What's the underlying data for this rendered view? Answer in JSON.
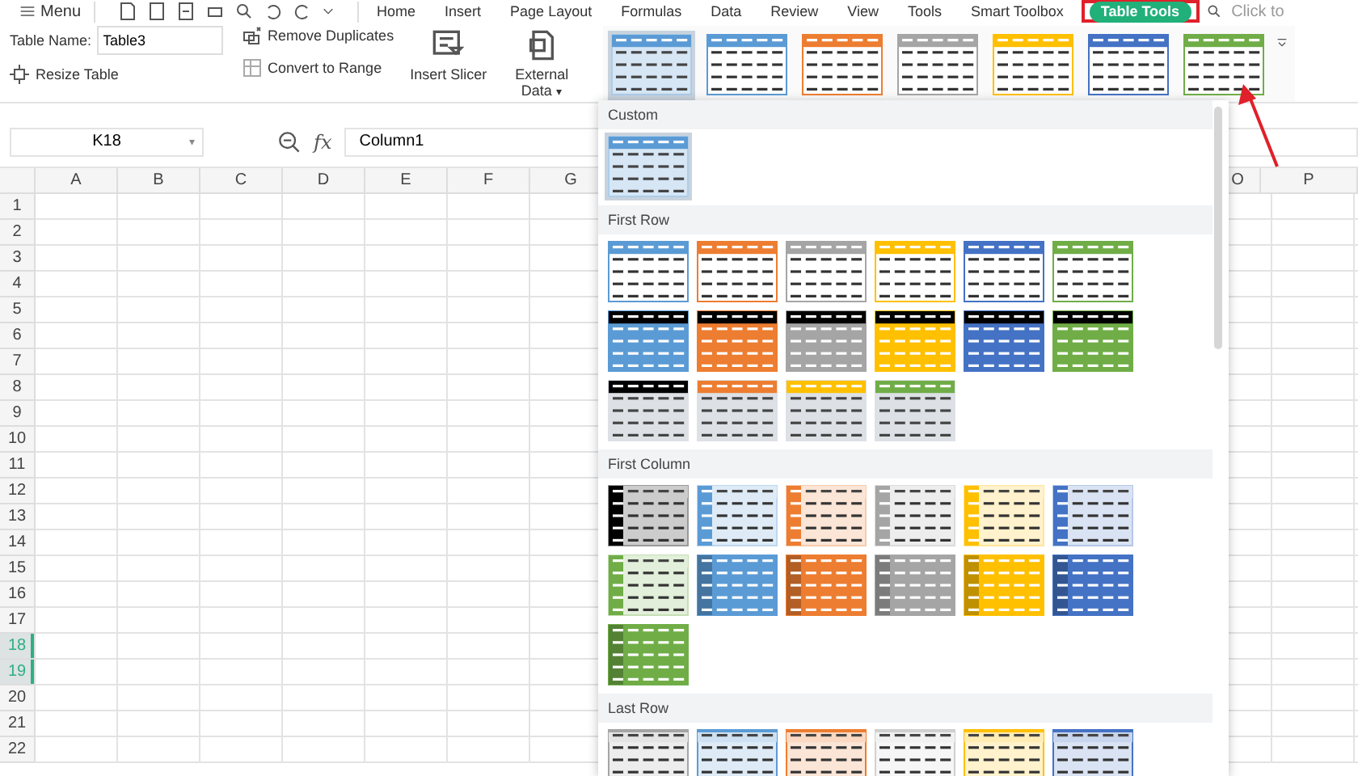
{
  "menu_bar": {
    "menu_label": "Menu",
    "tabs": [
      {
        "label": "Home",
        "selected": false
      },
      {
        "label": "Insert",
        "selected": false
      },
      {
        "label": "Page Layout",
        "selected": false
      },
      {
        "label": "Formulas",
        "selected": false
      },
      {
        "label": "Data",
        "selected": false
      },
      {
        "label": "Review",
        "selected": false
      },
      {
        "label": "View",
        "selected": false
      },
      {
        "label": "Tools",
        "selected": false
      },
      {
        "label": "Smart Toolbox",
        "selected": false
      },
      {
        "label": "Table Tools",
        "selected": true
      }
    ],
    "search": {
      "placeholder": "Click to"
    }
  },
  "ribbon": {
    "table_name_label": "Table Name:",
    "table_name_value": "Table3",
    "resize_table": "Resize Table",
    "remove_duplicates": "Remove Duplicates",
    "convert_to_range": "Convert to Range",
    "insert_slicer": "Insert Slicer",
    "external_data": "External Data",
    "external_data_caret": "▾",
    "styles": [
      {
        "kind": "custom",
        "color": "#5b9bd5",
        "selected": true
      },
      {
        "kind": "outline",
        "color": "#5b9bd5",
        "selected": false
      },
      {
        "kind": "outline",
        "color": "#ed7d31",
        "selected": false
      },
      {
        "kind": "outline",
        "color": "#a5a5a5",
        "selected": false
      },
      {
        "kind": "outline",
        "color": "#ffc000",
        "selected": false
      },
      {
        "kind": "outline",
        "color": "#4472c4",
        "selected": false
      },
      {
        "kind": "outline",
        "color": "#70ad47",
        "selected": false
      }
    ]
  },
  "formula_bar": {
    "name_box": "K18",
    "name_box_caret": "▾",
    "function_label": "fx",
    "formula": "Column1"
  },
  "sheet": {
    "columns": [
      "A",
      "B",
      "C",
      "D",
      "E",
      "F",
      "G",
      "O",
      "P"
    ],
    "rows": [
      {
        "label": "1",
        "selected": false
      },
      {
        "label": "2",
        "selected": false
      },
      {
        "label": "3",
        "selected": false
      },
      {
        "label": "4",
        "selected": false
      },
      {
        "label": "5",
        "selected": false
      },
      {
        "label": "6",
        "selected": false
      },
      {
        "label": "7",
        "selected": false
      },
      {
        "label": "8",
        "selected": false
      },
      {
        "label": "9",
        "selected": false
      },
      {
        "label": "10",
        "selected": false
      },
      {
        "label": "11",
        "selected": false
      },
      {
        "label": "12",
        "selected": false
      },
      {
        "label": "13",
        "selected": false
      },
      {
        "label": "14",
        "selected": false
      },
      {
        "label": "15",
        "selected": false
      },
      {
        "label": "16",
        "selected": false
      },
      {
        "label": "17",
        "selected": false
      },
      {
        "label": "18",
        "selected": true
      },
      {
        "label": "19",
        "selected": true
      },
      {
        "label": "20",
        "selected": false
      },
      {
        "label": "21",
        "selected": false
      },
      {
        "label": "22",
        "selected": false
      }
    ]
  },
  "style_gallery": {
    "sections": [
      {
        "title": "Custom",
        "styles": [
          {
            "kind": "custom",
            "color": "#5b9bd5",
            "selected": true
          }
        ]
      },
      {
        "title": "First Row",
        "styles": [
          {
            "kind": "outline",
            "color": "#5b9bd5",
            "selected": false
          },
          {
            "kind": "outline",
            "color": "#ed7d31",
            "selected": false
          },
          {
            "kind": "outline",
            "color": "#a5a5a5",
            "selected": false
          },
          {
            "kind": "outline",
            "color": "#ffc000",
            "selected": false
          },
          {
            "kind": "outline",
            "color": "#4472c4",
            "selected": false
          },
          {
            "kind": "outline",
            "color": "#70ad47",
            "selected": false
          },
          {
            "kind": "dark_header",
            "color": "#5b9bd5",
            "selected": false
          },
          {
            "kind": "dark_header",
            "color": "#ed7d31",
            "selected": false
          },
          {
            "kind": "dark_header",
            "color": "#a5a5a5",
            "selected": false
          },
          {
            "kind": "dark_header",
            "color": "#ffc000",
            "selected": false
          },
          {
            "kind": "dark_header",
            "color": "#4472c4",
            "selected": false
          },
          {
            "kind": "dark_header",
            "color": "#70ad47",
            "selected": false
          },
          {
            "kind": "light_header",
            "color": "#000000",
            "selected": false
          },
          {
            "kind": "light_header",
            "color": "#ed7d31",
            "selected": false
          },
          {
            "kind": "light_header",
            "color": "#ffc000",
            "selected": false
          },
          {
            "kind": "light_header",
            "color": "#70ad47",
            "selected": false
          }
        ]
      },
      {
        "title": "First Column",
        "styles": [
          {
            "kind": "first_col_light",
            "color": "#000000",
            "selected": false
          },
          {
            "kind": "first_col_light",
            "color": "#5b9bd5",
            "selected": false
          },
          {
            "kind": "first_col_light",
            "color": "#ed7d31",
            "selected": false
          },
          {
            "kind": "first_col_light",
            "color": "#a5a5a5",
            "selected": false
          },
          {
            "kind": "first_col_light",
            "color": "#ffc000",
            "selected": false
          },
          {
            "kind": "first_col_light",
            "color": "#4472c4",
            "selected": false
          },
          {
            "kind": "first_col_light",
            "color": "#70ad47",
            "selected": false
          },
          {
            "kind": "first_col_filled",
            "color": "#5b9bd5",
            "selected": false
          },
          {
            "kind": "first_col_filled",
            "color": "#ed7d31",
            "selected": false
          },
          {
            "kind": "first_col_filled",
            "color": "#a5a5a5",
            "selected": false
          },
          {
            "kind": "first_col_filled",
            "color": "#ffc000",
            "selected": false
          },
          {
            "kind": "first_col_filled",
            "color": "#4472c4",
            "selected": false
          },
          {
            "kind": "first_col_filled",
            "color": "#70ad47",
            "selected": false
          }
        ]
      },
      {
        "title": "Last Row",
        "styles": [
          {
            "kind": "plain_light",
            "color": "#a5a5a5",
            "selected": false
          },
          {
            "kind": "plain_light",
            "color": "#5b9bd5",
            "selected": false
          },
          {
            "kind": "plain_light",
            "color": "#ed7d31",
            "selected": false
          },
          {
            "kind": "plain_light",
            "color": "#d0d0d0",
            "selected": false
          },
          {
            "kind": "plain_light",
            "color": "#ffc000",
            "selected": false
          },
          {
            "kind": "plain_light",
            "color": "#4472c4",
            "selected": false
          }
        ]
      }
    ]
  }
}
